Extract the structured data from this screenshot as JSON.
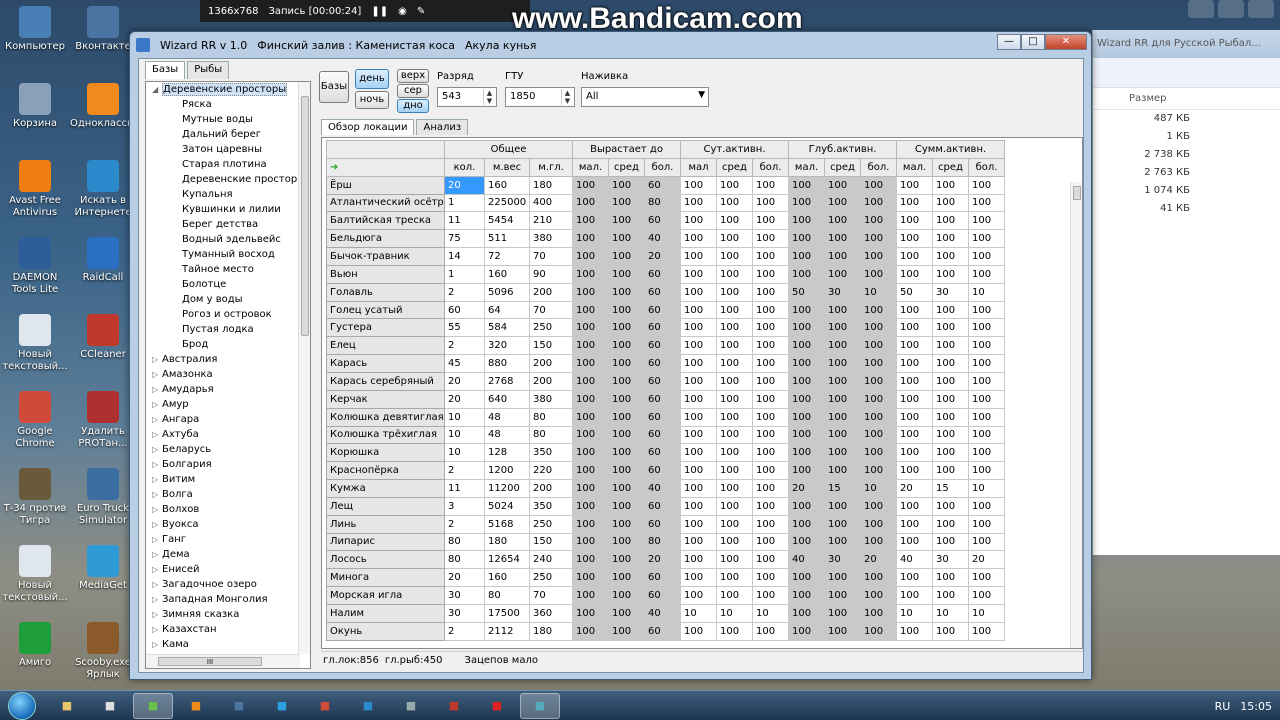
{
  "desktop": {
    "icons": [
      {
        "label": "Компьютер",
        "icon": "computer-icon",
        "color": "#4a7fb5"
      },
      {
        "label": "Вконтакте",
        "icon": "vk-icon",
        "color": "#4c75a3"
      },
      {
        "label": "Корзина",
        "icon": "recycle-bin-icon",
        "color": "#8aa0b8"
      },
      {
        "label": "Одноклассники",
        "icon": "ok-icon",
        "color": "#f08a1c"
      },
      {
        "label": "Avast Free Antivirus",
        "icon": "avast-icon",
        "color": "#f07d12"
      },
      {
        "label": "Искать в Интернете",
        "icon": "search-web-icon",
        "color": "#2a8acb"
      },
      {
        "label": "DAEMON Tools Lite",
        "icon": "daemon-icon",
        "color": "#2c5f9a"
      },
      {
        "label": "RaidCall",
        "icon": "raidcall-icon",
        "color": "#2a6fc1"
      },
      {
        "label": "Новый текстовый...",
        "icon": "text-file-icon",
        "color": "#dfe6ee"
      },
      {
        "label": "CCleaner",
        "icon": "ccleaner-icon",
        "color": "#c0392b"
      },
      {
        "label": "Google Chrome",
        "icon": "chrome-icon",
        "color": "#d04a3a"
      },
      {
        "label": "Удалить PROTан...",
        "icon": "uninstall-icon",
        "color": "#b03030"
      },
      {
        "label": "Т-34 против Тигра",
        "icon": "t34-icon",
        "color": "#6a5a3a"
      },
      {
        "label": "Euro Truck Simulator",
        "icon": "truck-icon",
        "color": "#3a6ea0"
      },
      {
        "label": "Новый текстовый...",
        "icon": "text-file-icon",
        "color": "#dfe6ee"
      },
      {
        "label": "MediaGet",
        "icon": "mediaget-icon",
        "color": "#2e9ad6"
      },
      {
        "label": "Амиго",
        "icon": "amigo-icon",
        "color": "#1e9e3a"
      },
      {
        "label": "Scooby.exe Ярлык",
        "icon": "scooby-icon",
        "color": "#8a5a2a"
      }
    ]
  },
  "bandicam": {
    "resolution": "1366x768",
    "recording": "Запись [00:00:24]",
    "url": "www.Bandicam.com"
  },
  "explorer": {
    "title": "Wizard RR для Русской Рыбал...",
    "size_header": "Размер",
    "sizes": [
      "487 КБ",
      "1 КБ",
      "2 738 КБ",
      "2 763 КБ",
      "1 074 КБ",
      "41 КБ"
    ]
  },
  "window": {
    "app": "Wizard RR v 1.0",
    "location": "Финский залив : Каменистая коса",
    "fish": "Акула кунья",
    "min": "—",
    "max": "□",
    "close": "✕"
  },
  "left": {
    "tabs": [
      "Базы",
      "Рыбы"
    ],
    "root": "Деревенские просторы",
    "children": [
      "Ряска",
      "Мутные воды",
      "Дальний берег",
      "Затон царевны",
      "Старая плотина",
      "Деревенские простор",
      "Купальня",
      "Кувшинки и лилии",
      "Берег детства",
      "Водный эдельвейс",
      "Туманный восход",
      "Тайное место",
      "Болотце",
      "Дом у воды",
      "Рогоз и островок",
      "Пустая лодка",
      "Брод"
    ],
    "others": [
      "Австралия",
      "Амазонка",
      "Амударья",
      "Амур",
      "Ангара",
      "Ахтуба",
      "Беларусь",
      "Болгария",
      "Витим",
      "Волга",
      "Волхов",
      "Вуокса",
      "Ганг",
      "Дема",
      "Енисей",
      "Загадочное озеро",
      "Западная Монголия",
      "Зимняя сказка",
      "Казахстан",
      "Кама"
    ],
    "hscroll": "III"
  },
  "toolbar": {
    "bases": "Базы",
    "day": "день",
    "night": "ночь",
    "top": "верх",
    "mid": "сер",
    "bottom": "дно",
    "razryad_label": "Разряд",
    "razryad": "543",
    "gtu_label": "ГТУ",
    "gtu": "1850",
    "bait_label": "Наживка",
    "bait": "All"
  },
  "inner_tabs": [
    "Обзор локации",
    "Анализ"
  ],
  "table": {
    "groups": [
      "Общее",
      "Вырастает до",
      "Сут.активн.",
      "Глуб.активн.",
      "Сумм.активн."
    ],
    "sub": [
      "кол.",
      "м.вес",
      "м.гл.",
      "мал.",
      "сред",
      "бол.",
      "мал",
      "сред",
      "бол.",
      "мал.",
      "сред",
      "бол.",
      "мал.",
      "сред",
      "бол."
    ],
    "rows": [
      [
        "Ёрш",
        "20",
        "160",
        "180",
        "100",
        "100",
        "60",
        "100",
        "100",
        "100",
        "100",
        "100",
        "100",
        "100",
        "100",
        "100"
      ],
      [
        "Атлантический осётр",
        "1",
        "225000",
        "400",
        "100",
        "100",
        "80",
        "100",
        "100",
        "100",
        "100",
        "100",
        "100",
        "100",
        "100",
        "100"
      ],
      [
        "Балтийская треска",
        "11",
        "5454",
        "210",
        "100",
        "100",
        "60",
        "100",
        "100",
        "100",
        "100",
        "100",
        "100",
        "100",
        "100",
        "100"
      ],
      [
        "Бельдюга",
        "75",
        "511",
        "380",
        "100",
        "100",
        "40",
        "100",
        "100",
        "100",
        "100",
        "100",
        "100",
        "100",
        "100",
        "100"
      ],
      [
        "Бычок-травник",
        "14",
        "72",
        "70",
        "100",
        "100",
        "20",
        "100",
        "100",
        "100",
        "100",
        "100",
        "100",
        "100",
        "100",
        "100"
      ],
      [
        "Вьюн",
        "1",
        "160",
        "90",
        "100",
        "100",
        "60",
        "100",
        "100",
        "100",
        "100",
        "100",
        "100",
        "100",
        "100",
        "100"
      ],
      [
        "Голавль",
        "2",
        "5096",
        "200",
        "100",
        "100",
        "60",
        "100",
        "100",
        "100",
        "50",
        "30",
        "10",
        "50",
        "30",
        "10"
      ],
      [
        "Голец усатый",
        "60",
        "64",
        "70",
        "100",
        "100",
        "60",
        "100",
        "100",
        "100",
        "100",
        "100",
        "100",
        "100",
        "100",
        "100"
      ],
      [
        "Густера",
        "55",
        "584",
        "250",
        "100",
        "100",
        "60",
        "100",
        "100",
        "100",
        "100",
        "100",
        "100",
        "100",
        "100",
        "100"
      ],
      [
        "Елец",
        "2",
        "320",
        "150",
        "100",
        "100",
        "60",
        "100",
        "100",
        "100",
        "100",
        "100",
        "100",
        "100",
        "100",
        "100"
      ],
      [
        "Карась",
        "45",
        "880",
        "200",
        "100",
        "100",
        "60",
        "100",
        "100",
        "100",
        "100",
        "100",
        "100",
        "100",
        "100",
        "100"
      ],
      [
        "Карась серебряный",
        "20",
        "2768",
        "200",
        "100",
        "100",
        "60",
        "100",
        "100",
        "100",
        "100",
        "100",
        "100",
        "100",
        "100",
        "100"
      ],
      [
        "Керчак",
        "20",
        "640",
        "380",
        "100",
        "100",
        "60",
        "100",
        "100",
        "100",
        "100",
        "100",
        "100",
        "100",
        "100",
        "100"
      ],
      [
        "Колюшка девятиглая",
        "10",
        "48",
        "80",
        "100",
        "100",
        "60",
        "100",
        "100",
        "100",
        "100",
        "100",
        "100",
        "100",
        "100",
        "100"
      ],
      [
        "Колюшка трёхиглая",
        "10",
        "48",
        "80",
        "100",
        "100",
        "60",
        "100",
        "100",
        "100",
        "100",
        "100",
        "100",
        "100",
        "100",
        "100"
      ],
      [
        "Корюшка",
        "10",
        "128",
        "350",
        "100",
        "100",
        "60",
        "100",
        "100",
        "100",
        "100",
        "100",
        "100",
        "100",
        "100",
        "100"
      ],
      [
        "Краснопёрка",
        "2",
        "1200",
        "220",
        "100",
        "100",
        "60",
        "100",
        "100",
        "100",
        "100",
        "100",
        "100",
        "100",
        "100",
        "100"
      ],
      [
        "Кумжа",
        "11",
        "11200",
        "200",
        "100",
        "100",
        "40",
        "100",
        "100",
        "100",
        "20",
        "15",
        "10",
        "20",
        "15",
        "10"
      ],
      [
        "Лещ",
        "3",
        "5024",
        "350",
        "100",
        "100",
        "60",
        "100",
        "100",
        "100",
        "100",
        "100",
        "100",
        "100",
        "100",
        "100"
      ],
      [
        "Линь",
        "2",
        "5168",
        "250",
        "100",
        "100",
        "60",
        "100",
        "100",
        "100",
        "100",
        "100",
        "100",
        "100",
        "100",
        "100"
      ],
      [
        "Липарис",
        "80",
        "180",
        "150",
        "100",
        "100",
        "80",
        "100",
        "100",
        "100",
        "100",
        "100",
        "100",
        "100",
        "100",
        "100"
      ],
      [
        "Лосось",
        "80",
        "12654",
        "240",
        "100",
        "100",
        "20",
        "100",
        "100",
        "100",
        "40",
        "30",
        "20",
        "40",
        "30",
        "20"
      ],
      [
        "Минога",
        "20",
        "160",
        "250",
        "100",
        "100",
        "60",
        "100",
        "100",
        "100",
        "100",
        "100",
        "100",
        "100",
        "100",
        "100"
      ],
      [
        "Морская игла",
        "30",
        "80",
        "70",
        "100",
        "100",
        "60",
        "100",
        "100",
        "100",
        "100",
        "100",
        "100",
        "100",
        "100",
        "100"
      ],
      [
        "Налим",
        "30",
        "17500",
        "360",
        "100",
        "100",
        "40",
        "10",
        "10",
        "10",
        "100",
        "100",
        "100",
        "10",
        "10",
        "10"
      ],
      [
        "Окунь",
        "2",
        "2112",
        "180",
        "100",
        "100",
        "60",
        "100",
        "100",
        "100",
        "100",
        "100",
        "100",
        "100",
        "100",
        "100"
      ]
    ]
  },
  "status": {
    "loc": "гл.лок:856",
    "fish": "гл.рыб:450",
    "bite": "Зацепов мало"
  },
  "taskbar": {
    "items": [
      "folder-icon",
      "arrow-icon",
      "wizard-icon",
      "ok-icon",
      "vk-icon",
      "skype-icon",
      "chrome-icon",
      "ie-icon",
      "settings-icon",
      "opera-icon",
      "rec-icon",
      "app-icon"
    ],
    "lang": "RU",
    "time": "15:05"
  }
}
